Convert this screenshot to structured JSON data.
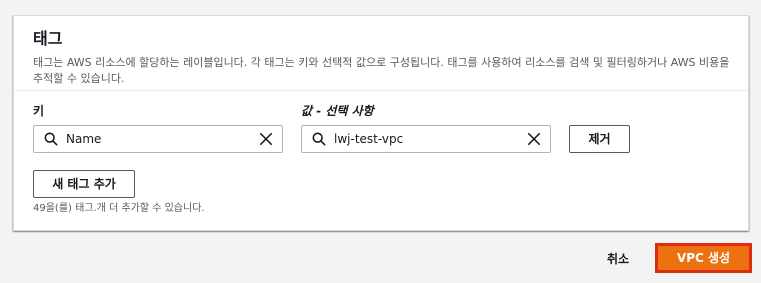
{
  "tags_panel": {
    "title": "태그",
    "description": "태그는 AWS 리소스에 할당하는 레이블입니다. 각 태그는 키와 선택적 값으로 구성됩니다. 태그를 사용하여 리소스를 검색 및 필터링하거나 AWS 비용을 추적할 수 있습니다.",
    "key_label": "키",
    "value_label": "값 - 선택 사항",
    "key_value": "Name",
    "value_value": "lwj-test-vpc",
    "remove_label": "제거",
    "add_tag_label": "새 태그 추가",
    "remaining_hint": "49을(를) 태그.개 더 추가할 수 있습니다."
  },
  "footer": {
    "cancel_label": "취소",
    "create_label": "VPC 생성"
  },
  "colors": {
    "primary": "#ec7211",
    "highlight_border": "#e02b10"
  },
  "icons": [
    "search-icon",
    "close-icon"
  ]
}
